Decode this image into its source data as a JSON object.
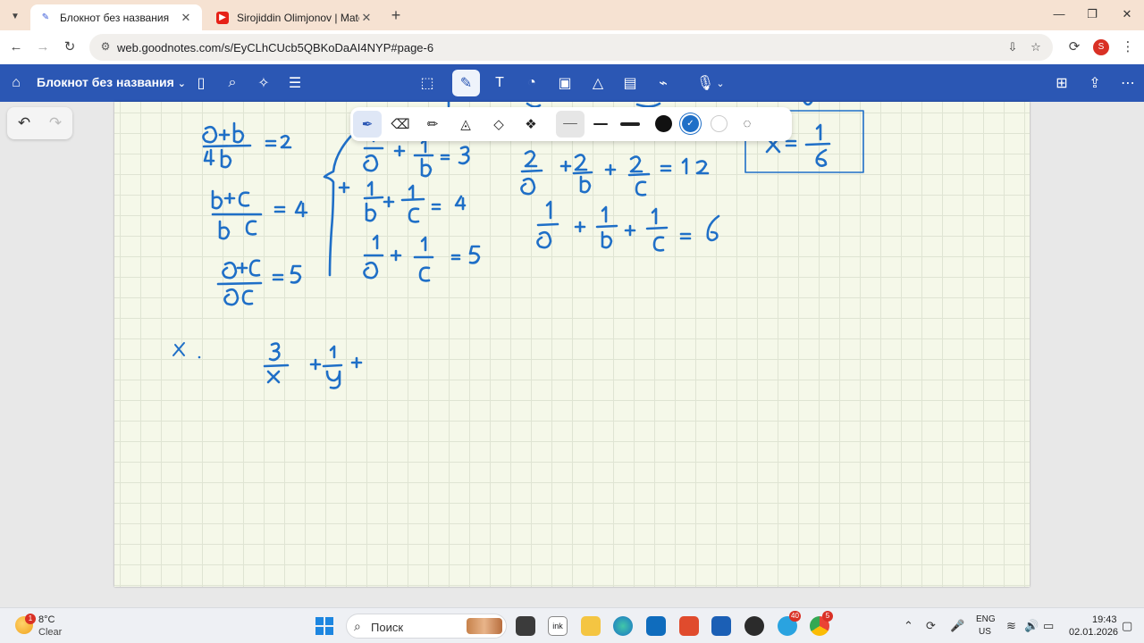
{
  "browser": {
    "tabs": [
      {
        "title": "Блокнот без названия",
        "active": true
      },
      {
        "title": "Sirojiddin Olimjonov | Matemat",
        "active": false
      }
    ],
    "url": "web.goodnotes.com/s/EyCLhCUcb5QBKoDaAI4NYP#page-6",
    "profile_initial": "S"
  },
  "app": {
    "notebook_title": "Блокнот без названия",
    "colors": {
      "appbar": "#2b57b4",
      "ink": "#1f6fc7",
      "paper": "#f5f8e9"
    }
  },
  "pen_toolbar": {
    "tools": [
      "fountain-pen",
      "eraser",
      "highlighter",
      "shape-tool",
      "lasso",
      "elements"
    ],
    "stroke_widths": [
      "thin",
      "medium",
      "thick"
    ],
    "colors": [
      "#111111",
      "#1f6fc7",
      "#ffffff"
    ],
    "selected_color": "#1f6fc7"
  },
  "handwriting": {
    "eq_left": [
      "(a+b)/(ab) = 2",
      "(b+c)/(bc) = 4",
      "(a+c)/(ac) = 5"
    ],
    "eq_middle": [
      "1/a + 1/b = 3",
      "1/b + 1/c = 4",
      "1/a + 1/c = 5"
    ],
    "eq_right": [
      "2/a + 2/b + 2/c = 12",
      "1/a + 1/b + 1/c = 6"
    ],
    "boxed": "x = 1/6",
    "bottom": [
      "x",
      "3/x + 1/y +"
    ]
  },
  "taskbar": {
    "weather_temp": "8°C",
    "weather_desc": "Clear",
    "weather_badge": "1",
    "search_placeholder": "Поиск",
    "telegram_badge": "40",
    "chrome_badge": "5",
    "lang_top": "ENG",
    "lang_bottom": "US",
    "time": "19:43",
    "date": "02.01.2026"
  }
}
